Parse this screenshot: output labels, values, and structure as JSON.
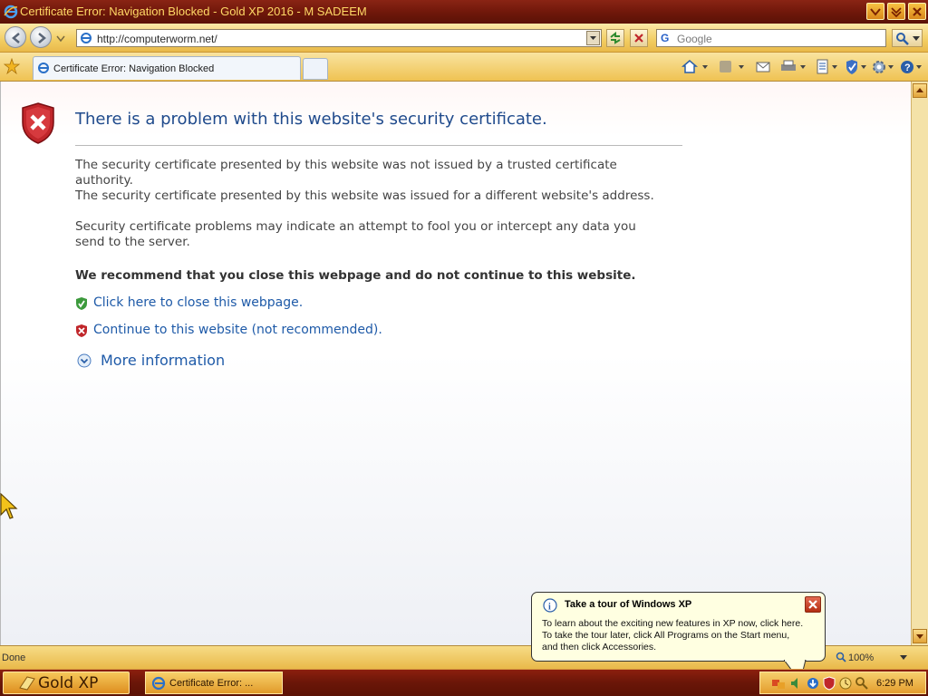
{
  "window": {
    "title": "Certificate Error: Navigation Blocked - Gold XP 2016 - M SADEEM"
  },
  "address_bar": {
    "url": "http://computerworm.net/"
  },
  "search_box": {
    "provider_icon": "G",
    "placeholder": "Google"
  },
  "tab": {
    "title": "Certificate Error: Navigation Blocked"
  },
  "page": {
    "headline": "There is a problem with this website's security certificate.",
    "para1_line1": "The security certificate presented by this website was not issued by a trusted certificate authority.",
    "para1_line2": "The security certificate presented by this website was issued for a different website's address.",
    "para2": "Security certificate problems may indicate an attempt to fool you or intercept any data you send to the server.",
    "recommendation": "We recommend that you close this webpage and do not continue to this website.",
    "close_link": "Click here to close this webpage.",
    "continue_link": "Continue to this website (not recommended).",
    "more_info": "More information"
  },
  "status_bar": {
    "status": "Done",
    "zoom": "100%"
  },
  "balloon": {
    "title": "Take a tour of Windows XP",
    "body_line1": "To learn about the exciting new features in XP now, click here.",
    "body_line2": "To take the tour later, click All Programs on the Start menu,",
    "body_line3": "and then click Accessories."
  },
  "taskbar": {
    "start_label": "Gold XP",
    "task_label": "Certificate Error: ...",
    "clock": "6:29 PM"
  },
  "colors": {
    "title_bar": "#6e170a",
    "chrome_gold": "#efc252",
    "link_blue": "#1e5aa8",
    "headline_blue": "#1f4a8c",
    "error_red": "#c0262a"
  }
}
